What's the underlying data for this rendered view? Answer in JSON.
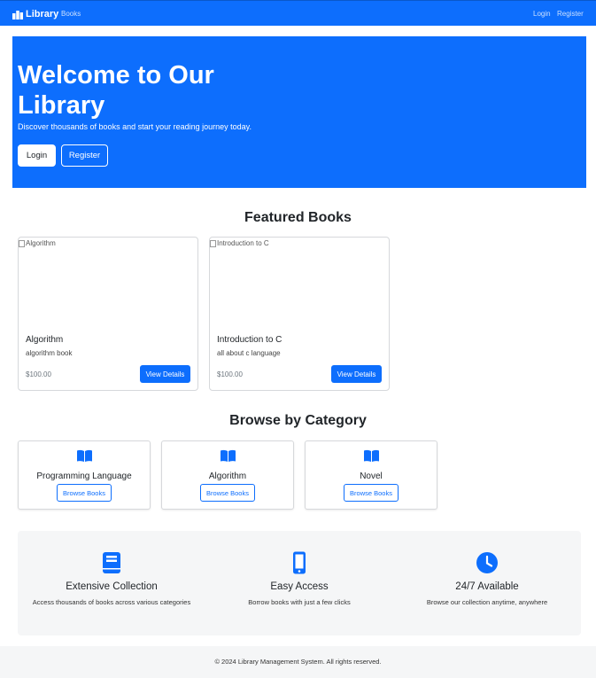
{
  "navbar": {
    "brand": "Library",
    "brand_icon": "books-icon",
    "links": [
      "Books"
    ],
    "right_links": [
      "Login",
      "Register"
    ],
    "background": "#0d6efd"
  },
  "hero": {
    "title": "Welcome to Our Library",
    "subtitle": "Discover thousands of books and start your reading journey today.",
    "buttons": [
      "Login",
      "Register"
    ],
    "background": "#0d6efd"
  },
  "featured": {
    "title": "Featured Books",
    "books": [
      {
        "image_alt": "Algorithm",
        "title": "Algorithm",
        "description": "algorithm book",
        "price": "$100.00",
        "button": "View Details"
      },
      {
        "image_alt": "Introduction to C",
        "title": "Introduction to C",
        "description": "all about c language",
        "price": "$100.00",
        "button": "View Details"
      }
    ]
  },
  "categories": {
    "title": "Browse by Category",
    "icon": "open-book-icon",
    "items": [
      {
        "name": "Programming Language",
        "button": "Browse Books"
      },
      {
        "name": "Algorithm",
        "button": "Browse Books"
      },
      {
        "name": "Novel",
        "button": "Browse Books"
      }
    ]
  },
  "features": [
    {
      "icon": "book-icon",
      "title": "Extensive Collection",
      "description": "Access thousands of books across various categories"
    },
    {
      "icon": "mobile-phone-icon",
      "title": "Easy Access",
      "description": "Borrow books with just a few clicks"
    },
    {
      "icon": "clock-icon",
      "title": "24/7 Available",
      "description": "Browse our collection anytime, anywhere"
    }
  ],
  "footer": {
    "text": "© 2024 Library Management System. All rights reserved."
  },
  "colors": {
    "primary": "#0d6efd",
    "light_background": "#f5f6f7"
  }
}
